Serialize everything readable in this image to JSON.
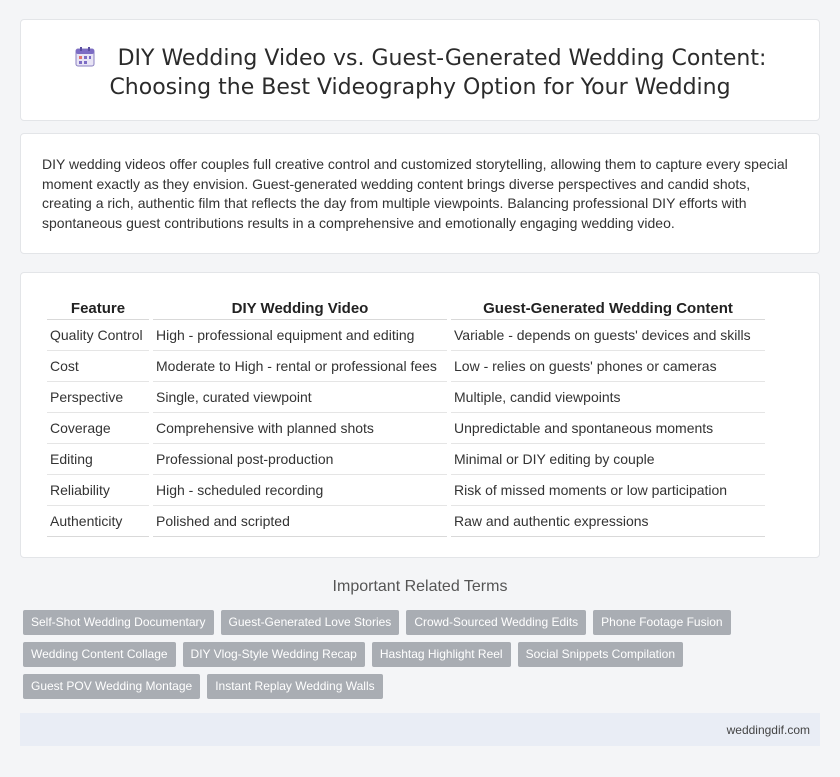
{
  "title": {
    "line1": "DIY Wedding Video vs. Guest-Generated Wedding Content:",
    "line2": "Choosing the Best Videography Option for Your Wedding",
    "icon": "calendar-icon"
  },
  "intro": "DIY wedding videos offer couples full creative control and customized storytelling, allowing them to capture every special moment exactly as they envision. Guest-generated wedding content brings diverse perspectives and candid shots, creating a rich, authentic film that reflects the day from multiple viewpoints. Balancing professional DIY efforts with spontaneous guest contributions results in a comprehensive and emotionally engaging wedding video.",
  "table": {
    "headers": [
      "Feature",
      "DIY Wedding Video",
      "Guest-Generated Wedding Content"
    ],
    "rows": [
      [
        "Quality Control",
        "High - professional equipment and editing",
        "Variable - depends on guests' devices and skills"
      ],
      [
        "Cost",
        "Moderate to High - rental or professional fees",
        "Low - relies on guests' phones or cameras"
      ],
      [
        "Perspective",
        "Single, curated viewpoint",
        "Multiple, candid viewpoints"
      ],
      [
        "Coverage",
        "Comprehensive with planned shots",
        "Unpredictable and spontaneous moments"
      ],
      [
        "Editing",
        "Professional post-production",
        "Minimal or DIY editing by couple"
      ],
      [
        "Reliability",
        "High - scheduled recording",
        "Risk of missed moments or low participation"
      ],
      [
        "Authenticity",
        "Polished and scripted",
        "Raw and authentic expressions"
      ]
    ]
  },
  "related": {
    "title": "Important Related Terms",
    "tags": [
      "Self-Shot Wedding Documentary",
      "Guest-Generated Love Stories",
      "Crowd-Sourced Wedding Edits",
      "Phone Footage Fusion",
      "Wedding Content Collage",
      "DIY Vlog-Style Wedding Recap",
      "Hashtag Highlight Reel",
      "Social Snippets Compilation",
      "Guest POV Wedding Montage",
      "Instant Replay Wedding Walls"
    ]
  },
  "footer": "weddingdif.com",
  "colors": {
    "tag_bg": "#a9adb3",
    "footer_bg": "#e9edf5",
    "page_bg": "#f4f5f7"
  }
}
